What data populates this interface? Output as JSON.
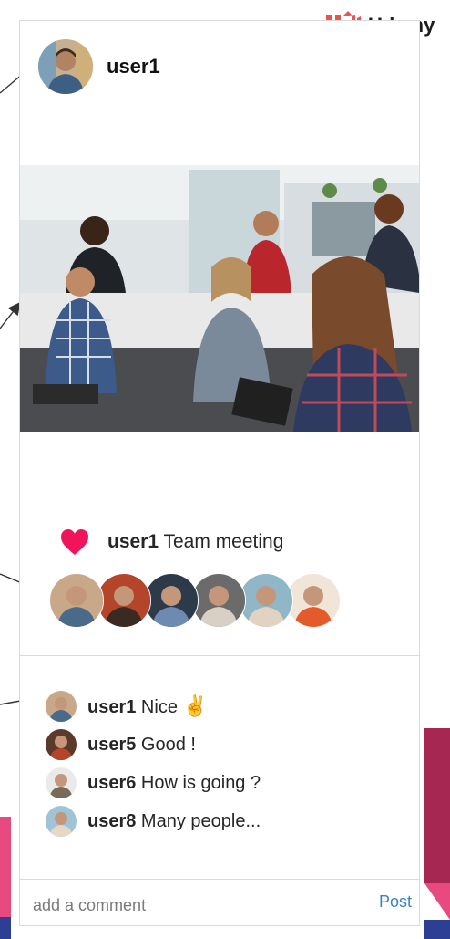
{
  "brand": {
    "name": "Udemy",
    "color": "#ec5252"
  },
  "post": {
    "username": "user1",
    "photo_icon": "team-meeting-photo",
    "caption_user": "user1",
    "caption_text": " Team meeting",
    "liked": true,
    "heart_color": "#f0145a"
  },
  "likers": [
    {
      "name": "liker-avatar-1",
      "colors": [
        "#c9a88a",
        "#4a6a8a"
      ]
    },
    {
      "name": "liker-avatar-2",
      "colors": [
        "#b5452a",
        "#3a2a22"
      ]
    },
    {
      "name": "liker-avatar-3",
      "colors": [
        "#2d3a4a",
        "#6d8ab0"
      ]
    },
    {
      "name": "liker-avatar-4",
      "colors": [
        "#6b6b6b",
        "#d8d0c4"
      ]
    },
    {
      "name": "liker-avatar-5",
      "colors": [
        "#8fb7c8",
        "#e2d2c2"
      ]
    },
    {
      "name": "liker-avatar-6",
      "colors": [
        "#f1e5d8",
        "#e55a2a"
      ]
    }
  ],
  "comments": [
    {
      "user": "user1",
      "text": " Nice ",
      "emoji": "✌",
      "avatar": [
        "#c9a88a",
        "#4a6a8a"
      ]
    },
    {
      "user": "user5",
      "text": " Good !",
      "avatar": [
        "#5a3a2a",
        "#b5452a"
      ]
    },
    {
      "user": "user6",
      "text": " How is going ?",
      "avatar": [
        "#eaeaea",
        "#7a6a5a"
      ]
    },
    {
      "user": "user8",
      "text": " Many people...",
      "avatar": [
        "#9fc4d6",
        "#e7d7c7"
      ]
    }
  ],
  "comment_box": {
    "placeholder": "add a comment",
    "post_label": "Post"
  }
}
